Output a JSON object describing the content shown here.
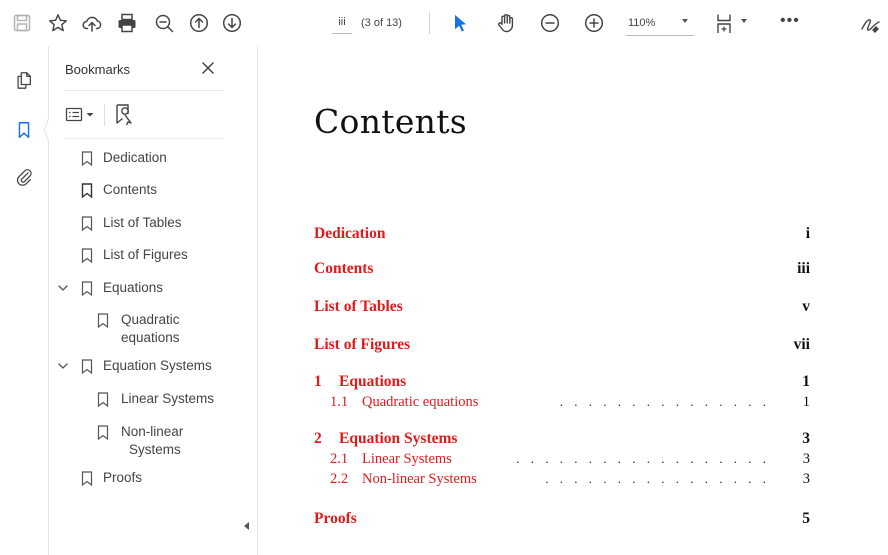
{
  "toolbar": {
    "page_label": "iii",
    "page_count": "(3 of 13)",
    "zoom": "110%",
    "more": "•••",
    "active_tool_color": "#1473e6"
  },
  "icons": {
    "save": "save-icon",
    "bookmark": "bookmark-star-icon",
    "upload": "cloud-upload-icon",
    "print": "printer-icon",
    "zoom_search": "zoom-search-icon",
    "prev_page": "arrow-up-circle-icon",
    "next_page": "arrow-down-circle-icon",
    "select": "pointer-arrow-icon",
    "hand": "hand-icon",
    "zoom_out": "minus-circle-icon",
    "zoom_in": "plus-circle-icon",
    "fit_page": "fit-page-icon",
    "sign": "sign-icon"
  },
  "rail": {
    "items": [
      "pages-icon",
      "bookmarks-icon",
      "attachments-icon"
    ]
  },
  "bookmarks_panel": {
    "title": "Bookmarks",
    "items": [
      {
        "label": "Dedication"
      },
      {
        "label": "Contents"
      },
      {
        "label": "List of Tables"
      },
      {
        "label": "List of Figures"
      },
      {
        "label": "Equations",
        "expanded": true
      },
      {
        "label_line1": "Quadratic",
        "label_line2": "equations"
      },
      {
        "label": "Equation Systems",
        "expanded": true
      },
      {
        "label": "Linear Systems"
      },
      {
        "label_line1": "Non-linear",
        "label_line2": "Systems"
      },
      {
        "label": "Proofs"
      }
    ]
  },
  "document": {
    "heading": "Contents",
    "toc": [
      {
        "title": "Dedication",
        "page": "i"
      },
      {
        "title": "Contents",
        "page": "iii"
      },
      {
        "title": "List of Tables",
        "page": "v"
      },
      {
        "title": "List of Figures",
        "page": "vii"
      },
      {
        "num": "1",
        "title": "Equations",
        "page": "1",
        "sections": [
          {
            "num": "1.1",
            "title": "Quadratic equations",
            "page": "1"
          }
        ]
      },
      {
        "num": "2",
        "title": "Equation Systems",
        "page": "3",
        "sections": [
          {
            "num": "2.1",
            "title": "Linear Systems",
            "page": "3"
          },
          {
            "num": "2.2",
            "title": "Non-linear Systems",
            "page": "3"
          }
        ]
      },
      {
        "title": "Proofs",
        "page": "5"
      }
    ],
    "link_color": "#e11b1b"
  }
}
